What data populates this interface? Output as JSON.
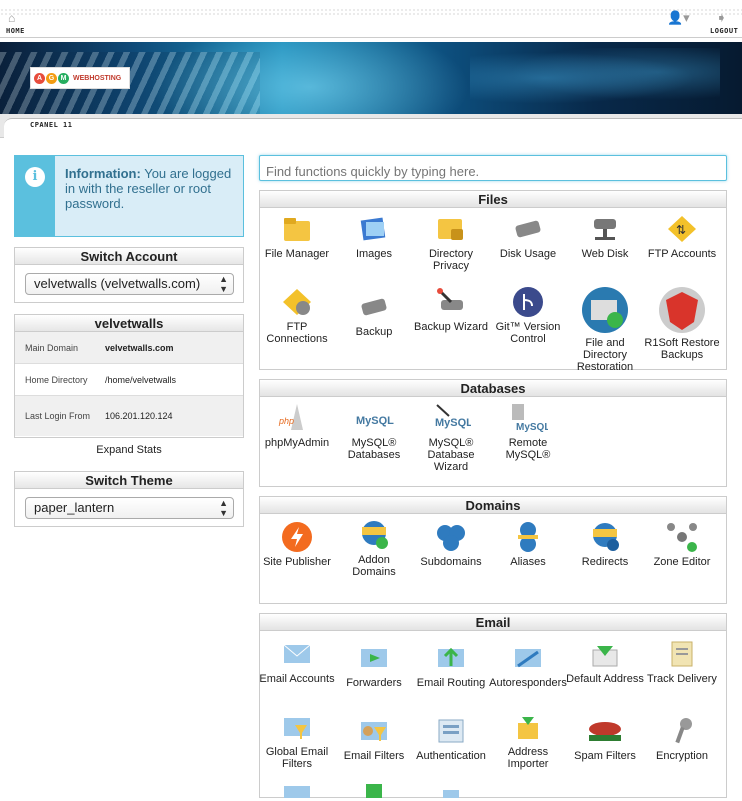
{
  "topbar": {
    "home_label": "HOME",
    "logout_label": "LOGOUT"
  },
  "subbar": {
    "label": "CPANEL 11"
  },
  "logo": {
    "letters": [
      "A",
      "G",
      "M"
    ],
    "text": "WEBHOSTING"
  },
  "info": {
    "title": "Information:",
    "text": "You are logged in with the reseller or root password."
  },
  "switch_account": {
    "title": "Switch Account",
    "selected": "velvetwalls (velvetwalls.com)"
  },
  "stats": {
    "title": "velvetwalls",
    "rows": [
      {
        "key": "Main Domain",
        "value": "velvetwalls.com"
      },
      {
        "key": "Home Directory",
        "value": "/home/velvetwalls"
      },
      {
        "key": "Last Login From",
        "value": "106.201.120.124"
      }
    ],
    "expand_label": "Expand Stats"
  },
  "switch_theme": {
    "title": "Switch Theme",
    "selected": "paper_lantern"
  },
  "search": {
    "placeholder": "Find functions quickly by typing here."
  },
  "groups": {
    "files": {
      "title": "Files",
      "items": [
        "File Manager",
        "Images",
        "Directory Privacy",
        "Disk Usage",
        "Web Disk",
        "FTP Accounts",
        "FTP Connections",
        "Backup",
        "Backup Wizard",
        "Git™ Version Control",
        "File and Directory Restoration",
        "R1Soft Restore Backups"
      ]
    },
    "databases": {
      "title": "Databases",
      "items": [
        "phpMyAdmin",
        "MySQL® Databases",
        "MySQL® Database Wizard",
        "Remote MySQL®"
      ]
    },
    "domains": {
      "title": "Domains",
      "items": [
        "Site Publisher",
        "Addon Domains",
        "Subdomains",
        "Aliases",
        "Redirects",
        "Zone Editor"
      ]
    },
    "email": {
      "title": "Email",
      "items": [
        "Email Accounts",
        "Forwarders",
        "Email Routing",
        "Autoresponders",
        "Default Address",
        "Track Delivery",
        "Global Email Filters",
        "Email Filters",
        "Authentication",
        "Address Importer",
        "Spam Filters",
        "Encryption"
      ]
    }
  },
  "colors": {
    "accent": "#5bc0de",
    "info_bg": "#d9edf7",
    "info_text": "#31708f"
  }
}
